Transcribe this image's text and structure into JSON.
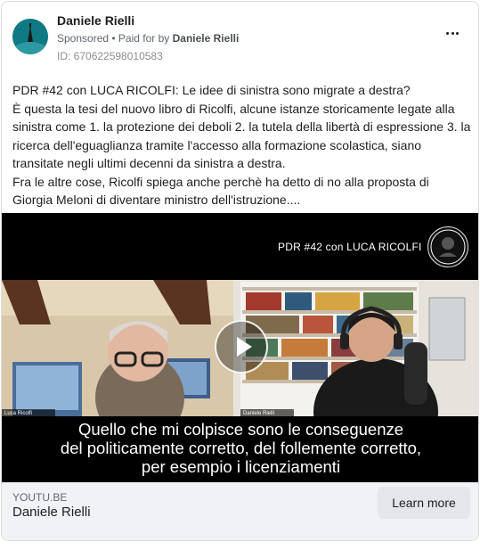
{
  "post": {
    "author": "Daniele Rielli",
    "sponsored": "Sponsored",
    "paid_prefix": " • Paid for by ",
    "paid_by": "Daniele Rielli",
    "ad_id": "ID: 670622598010583",
    "body": [
      "PDR #42 con LUCA RICOLFI: Le idee di sinistra sono migrate a destra?",
      "È questa la tesi del nuovo libro di Ricolfi, alcune istanze storicamente legate alla sinistra come 1. la protezione dei deboli 2. la tutela della libertà di espressione 3. la ricerca dell'eguaglianza tramite l'accesso alla formazione scolastica, siano transitate negli ultimi decenni da sinistra a destra.",
      "Fra le altre cose, Ricolfi spiega anche perchè ha detto di no alla proposta di Giorgia Meloni di diventare ministro dell'istruzione...."
    ]
  },
  "media": {
    "video_title": "PDR #42 con LUCA RICOLFI",
    "name_tag_left": "Luca Ricolfi",
    "name_tag_right": "Daniele Rielli",
    "caption": [
      "Quello che mi colpisce sono le conseguenze",
      "del politicamente corretto, del follemente corretto,",
      "per esempio i licenziamenti"
    ]
  },
  "link": {
    "domain": "YOUTU.BE",
    "title": "Daniele Rielli",
    "cta": "Learn more"
  },
  "colors": {
    "text": "#1c1e21",
    "secondary": "#606770",
    "footer_bg": "#f0f2f5",
    "button_bg": "#e4e6eb"
  }
}
